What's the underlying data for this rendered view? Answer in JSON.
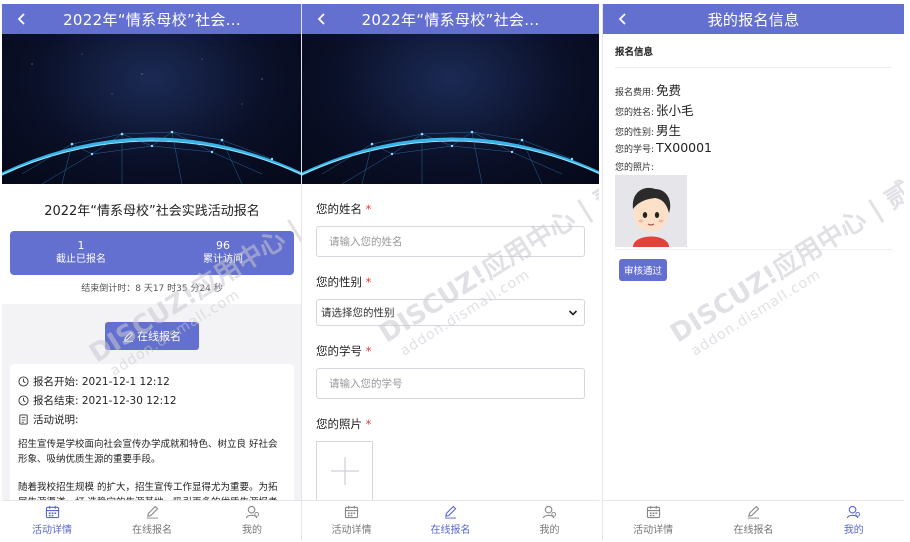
{
  "colors": {
    "primary": "#6470cf",
    "required": "#e23a3a"
  },
  "panel1": {
    "title": "2022年“情系母校”社会...",
    "heading": "2022年“情系母校”社会实践活动报名",
    "stats": [
      {
        "value": "1",
        "label": "截止已报名"
      },
      {
        "value": "96",
        "label": "累计访问"
      }
    ],
    "countdown": "结束倒计时：8 天17 时35 分24 秒",
    "signup_button": "在线报名",
    "start_row": "报名开始: 2021-12-1 12:12",
    "end_row": "报名结束: 2021-12-30 12:12",
    "desc_label": "活动说明:",
    "paragraph1": "招生宣传是学校面向社会宣传办学成就和特色、树立良 好社会形象、吸纳优质生源的重要手段。",
    "paragraph2": "随着我校招生规模 的扩大，招生宣传工作显得尤为重要。为拓展生源渠道，打 造稳定的生源基地，吸引更多的优质生源报考我"
  },
  "panel2": {
    "title": "2022年“情系母校”社会...",
    "name_label": "您的姓名",
    "name_placeholder": "请输入您的姓名",
    "gender_label": "您的性别",
    "gender_selected": "请选择您的性别",
    "id_label": "您的学号",
    "id_placeholder": "请输入您的学号",
    "photo_label": "您的照片",
    "required_mark": "*"
  },
  "panel3": {
    "title": "我的报名信息",
    "section": "报名信息",
    "fee_label": "报名费用:",
    "fee_value": "免费",
    "name_label": "您的姓名:",
    "name_value": "张小毛",
    "gender_label": "您的性别:",
    "gender_value": "男生",
    "id_label": "您的学号:",
    "id_value": "TX00001",
    "photo_label": "您的照片:",
    "status_button": "审核通过"
  },
  "tabs": {
    "detail": "活动详情",
    "signup": "在线报名",
    "mine": "我的"
  },
  "watermark": {
    "line1": "DISCUZ!应用中心 | 贰道",
    "line2": "addon.dismall.com"
  }
}
